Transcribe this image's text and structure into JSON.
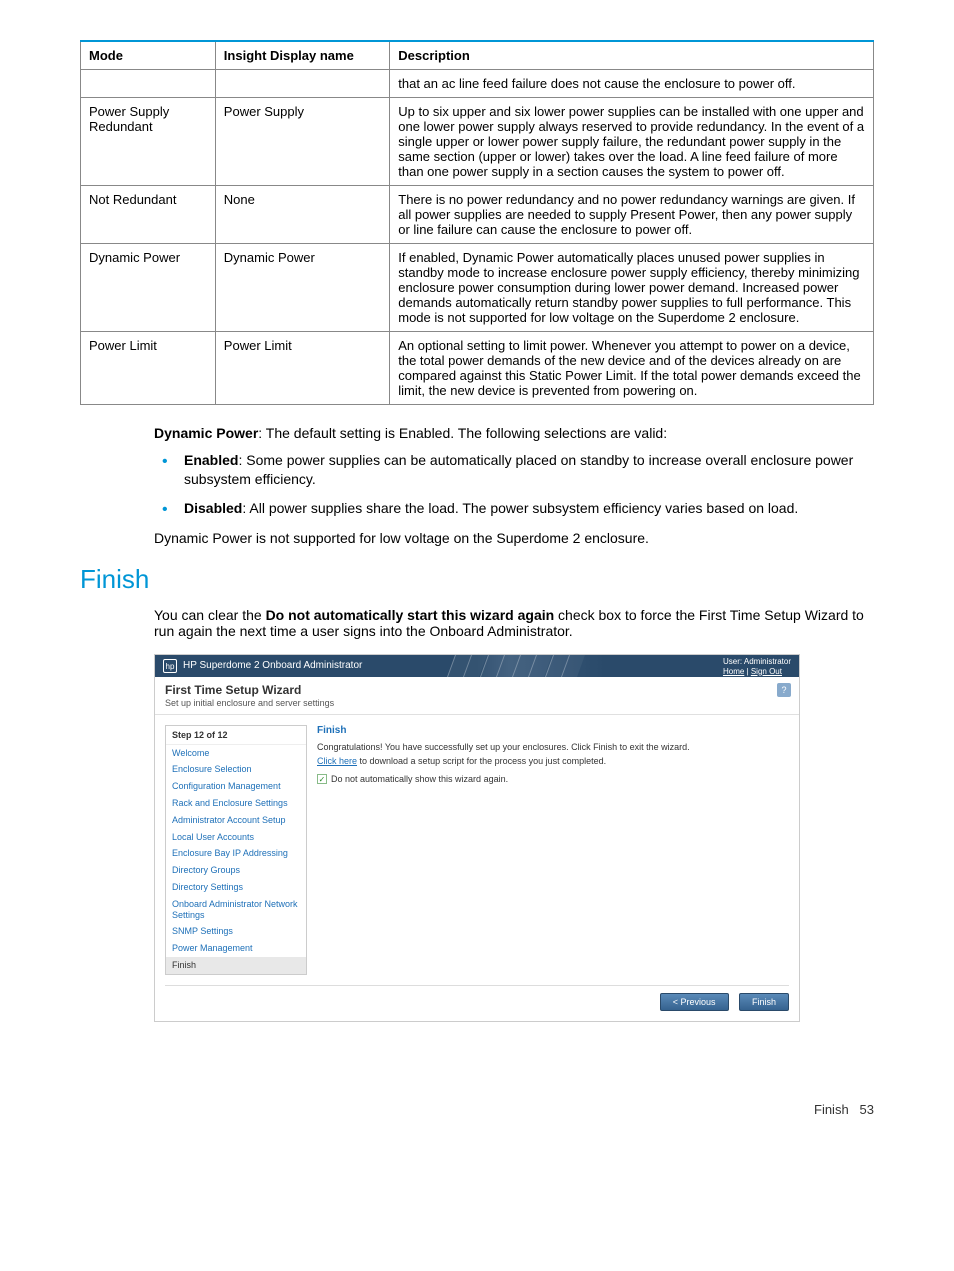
{
  "table": {
    "headers": [
      "Mode",
      "Insight Display name",
      "Description"
    ],
    "rows": [
      {
        "mode": "",
        "display": "",
        "desc": "that an ac line feed failure does not cause the enclosure to power off."
      },
      {
        "mode": "Power Supply Redundant",
        "display": "Power Supply",
        "desc": "Up to six upper and six lower power supplies can be installed with one upper and one lower power supply always reserved to provide redundancy. In the event of a single upper or lower power supply failure, the redundant power supply in the same section (upper or lower) takes over the load. A line feed failure of more than one power supply in a section causes the system to power off."
      },
      {
        "mode": "Not Redundant",
        "display": "None",
        "desc": "There is no power redundancy and no power redundancy warnings are given. If all power supplies are needed to supply Present Power, then any power supply or line failure can cause the enclosure to power off."
      },
      {
        "mode": "Dynamic Power",
        "display": "Dynamic Power",
        "desc": "If enabled, Dynamic Power automatically places unused power supplies in standby mode to increase enclosure power supply efficiency, thereby minimizing enclosure power consumption during lower power demand. Increased power demands automatically return standby power supplies to full performance. This mode is not supported for low voltage on the Superdome 2 enclosure."
      },
      {
        "mode": "Power Limit",
        "display": "Power Limit",
        "desc": "An optional setting to limit power. Whenever you attempt to power on a device, the total power demands of the new device and of the devices already on are compared against this Static Power Limit. If the total power demands exceed the limit, the new device is prevented from powering on."
      }
    ]
  },
  "dynamic_intro_bold": "Dynamic Power",
  "dynamic_intro_rest": ": The default setting is Enabled. The following selections are valid:",
  "bullets": [
    {
      "bold": "Enabled",
      "rest": ": Some power supplies can be automatically placed on standby to increase overall enclosure power subsystem efficiency."
    },
    {
      "bold": "Disabled",
      "rest": ": All power supplies share the load. The power subsystem efficiency varies based on load."
    }
  ],
  "dynamic_note": "Dynamic Power is not supported for low voltage on the Superdome 2 enclosure.",
  "finish_heading": "Finish",
  "finish_intro_pre": "You can clear the ",
  "finish_intro_bold": "Do not automatically start this wizard again",
  "finish_intro_post": " check box to force the First Time Setup Wizard to run again the next time a user signs into the Onboard Administrator.",
  "screenshot": {
    "topbar_title": "HP Superdome 2 Onboard Administrator",
    "user_label": "User: Administrator",
    "home_link": "Home",
    "signout_link": "Sign Out",
    "wiz_title": "First Time Setup Wizard",
    "wiz_subtitle": "Set up initial enclosure and server settings",
    "help_icon": "?",
    "sidebar": {
      "header": "Step 12 of 12",
      "items": [
        "Welcome",
        "Enclosure Selection",
        "Configuration Management",
        "Rack and Enclosure Settings",
        "Administrator Account Setup",
        "Local User Accounts",
        "Enclosure Bay IP Addressing",
        "Directory Groups",
        "Directory Settings",
        "Onboard Administrator Network Settings",
        "SNMP Settings",
        "Power Management",
        "Finish"
      ]
    },
    "main": {
      "title": "Finish",
      "p1": "Congratulations! You have successfully set up your enclosures. Click Finish to exit the wizard.",
      "p2_link": "Click here",
      "p2_rest": " to download a setup script for the process you just completed.",
      "checkbox_label": "Do not automatically show this wizard again.",
      "checkbox_mark": "✓"
    },
    "buttons": {
      "prev": "< Previous",
      "finish": "Finish"
    }
  },
  "footer": {
    "label": "Finish",
    "page": "53"
  }
}
